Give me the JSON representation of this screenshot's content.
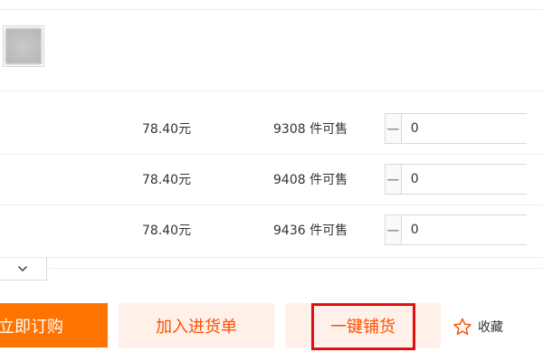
{
  "sku_rows": [
    {
      "price": "78.40元",
      "stock": "9308 件可售",
      "quantity": "0"
    },
    {
      "price": "78.40元",
      "stock": "9408 件可售",
      "quantity": "0"
    },
    {
      "price": "78.40元",
      "stock": "9436 件可售",
      "quantity": "0"
    }
  ],
  "stepper": {
    "minus": "−",
    "plus": "+"
  },
  "actions": {
    "buy_now": "立即订购",
    "add_to_cart": "加入进货单",
    "one_click_distribute": "一键铺货",
    "favorite": "收藏"
  },
  "icons": {
    "collapse": "chevron-down-icon",
    "favorite": "star-outline-icon"
  },
  "colors": {
    "primary": "#ff7300",
    "secondary_bg": "#fff0ea",
    "secondary_text": "#ff5000",
    "highlight_border": "#e01010"
  }
}
